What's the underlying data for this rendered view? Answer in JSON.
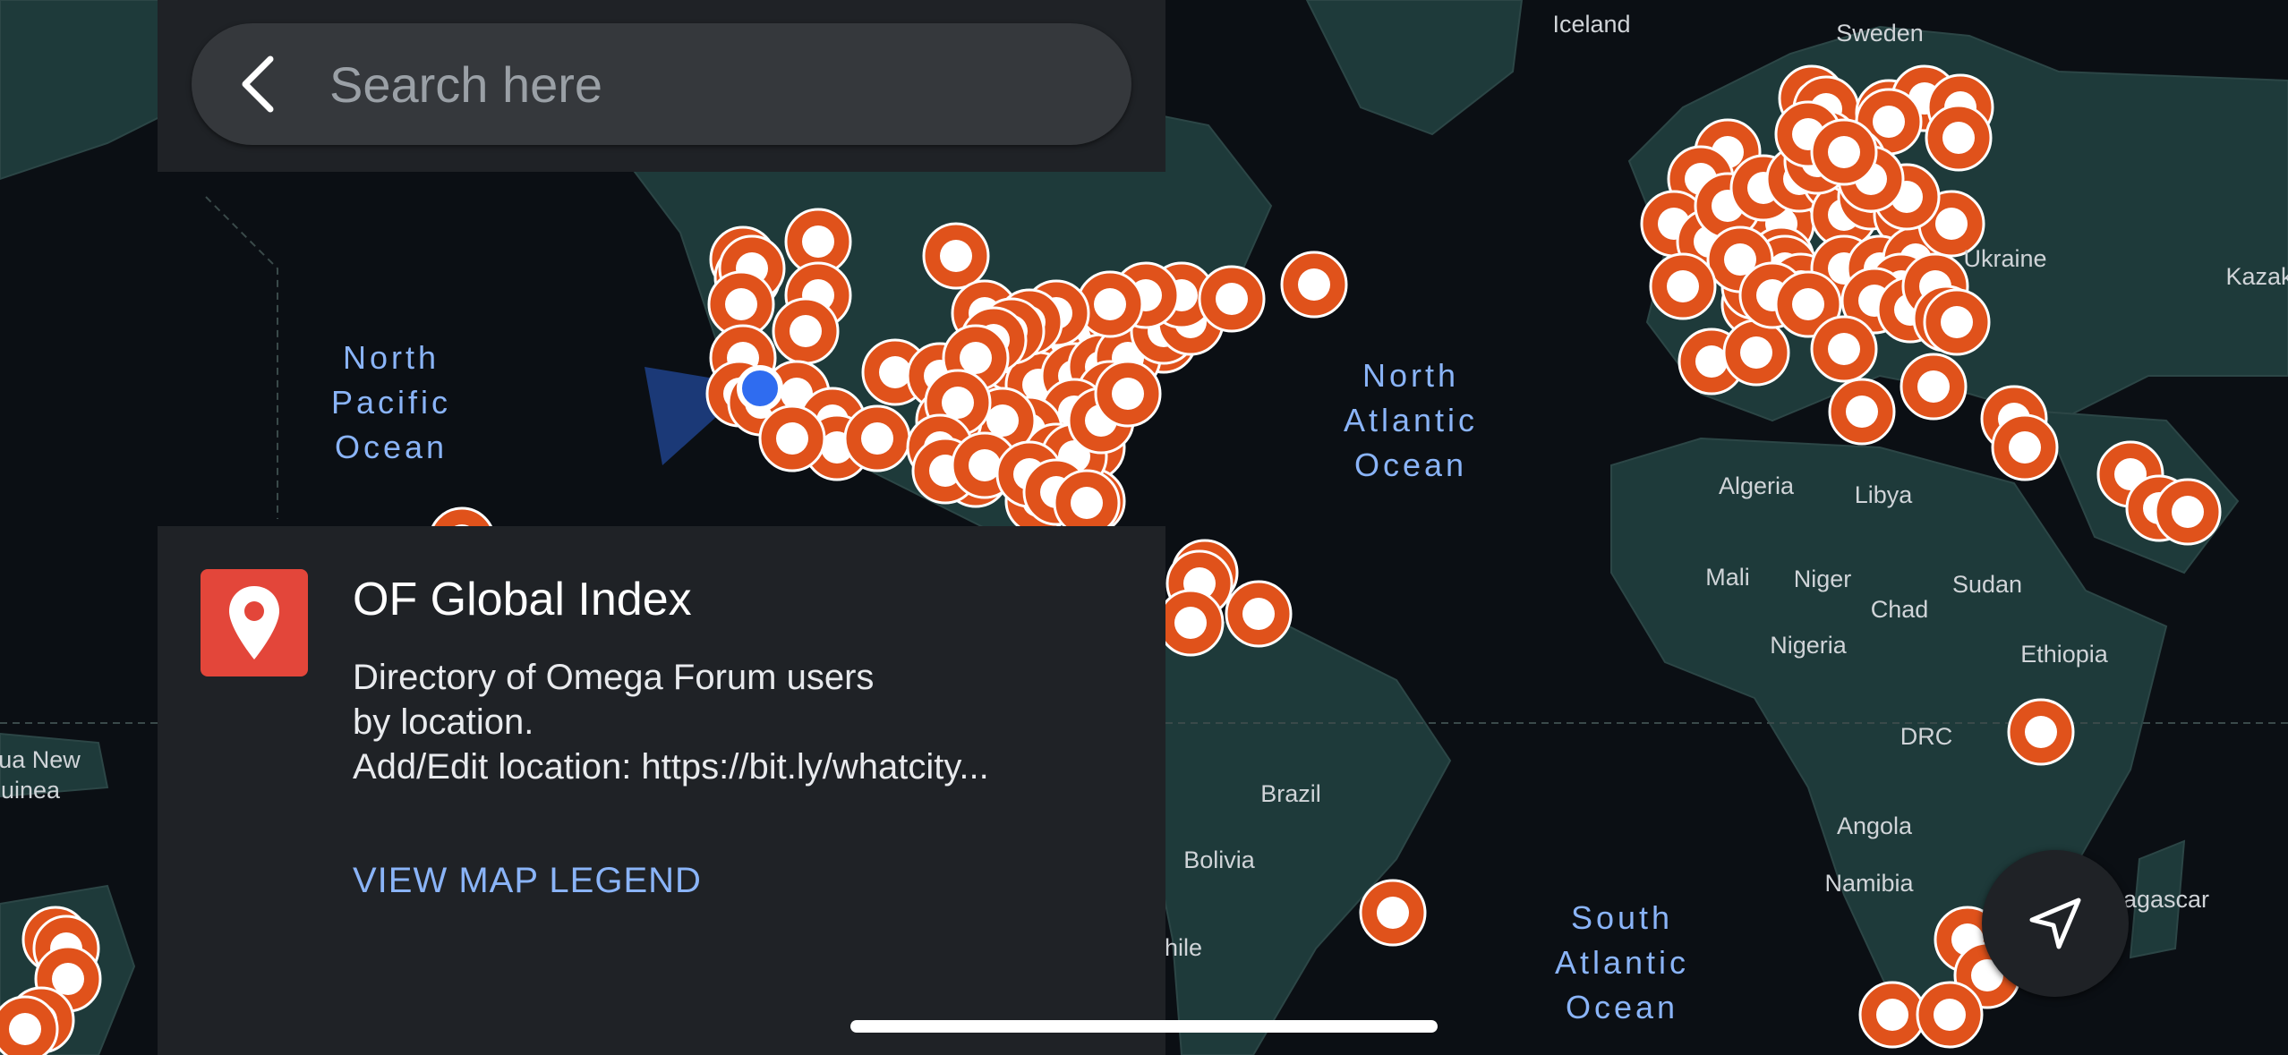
{
  "search": {
    "placeholder": "Search here",
    "back_icon": "back-arrow-icon"
  },
  "panel": {
    "icon": "map-pin-icon",
    "icon_color": "#e3463a",
    "title": "OF Global Index",
    "description_lines": [
      "Directory of Omega Forum users",
      "by location.",
      "Add/Edit location: https://bit.ly/whatcity..."
    ],
    "legend_link": "VIEW MAP LEGEND"
  },
  "nav_button": {
    "icon": "navigation-arrow-icon"
  },
  "map": {
    "marker_color": "#e0521b",
    "user_location_color": "#2f6cf0",
    "labels": {
      "north_pacific": [
        "North",
        "Pacific",
        "Ocean"
      ],
      "north_atlantic": [
        "North",
        "Atlantic",
        "Ocean"
      ],
      "south_atlantic": [
        "South",
        "Atlantic",
        "Ocean"
      ],
      "iceland": "Iceland",
      "sweden": "Sweden",
      "ukraine": "Ukraine",
      "kazakhstan": "Kazak",
      "algeria": "Algeria",
      "libya": "Libya",
      "mali": "Mali",
      "niger": "Niger",
      "sudan": "Sudan",
      "chad": "Chad",
      "nigeria": "Nigeria",
      "ethiopia": "Ethiopia",
      "drc": "DRC",
      "angola": "Angola",
      "namibia": "Namibia",
      "madagascar": "agascar",
      "brazil": "Brazil",
      "bolivia": "Bolivia",
      "chile": "hile",
      "png_1": "ua New",
      "png_2": "uinea"
    }
  }
}
